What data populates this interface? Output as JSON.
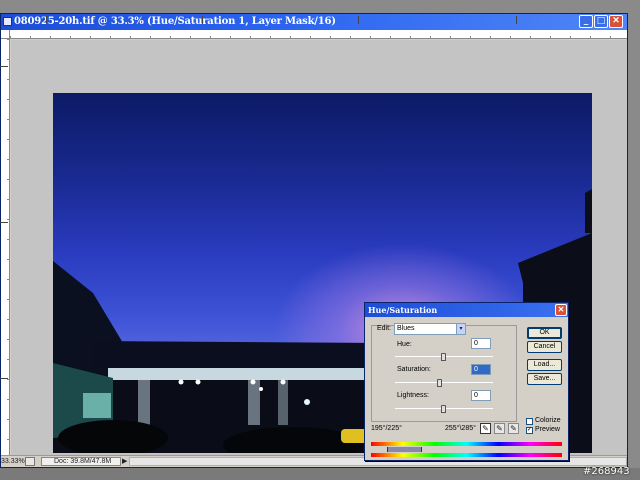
{
  "window": {
    "title": "080925-20h.tif @ 33.3% (Hue/Saturation 1, Layer Mask/16)",
    "minimize_glyph": "_",
    "maximize_glyph": "□",
    "close_glyph": "✕"
  },
  "status": {
    "zoom": "33.33%",
    "doc": "Doc: 39.8M/47.8M",
    "arrow": "▶"
  },
  "dialog": {
    "title": "Hue/Saturation",
    "close_glyph": "✕",
    "edit_label": "Edit:",
    "edit_value": "Blues",
    "edit_caret": "▾",
    "hue_label": "Hue:",
    "hue_value": "0",
    "saturation_label": "Saturation:",
    "saturation_value": "0",
    "lightness_label": "Lightness:",
    "lightness_value": "0",
    "ok_label": "OK",
    "cancel_label": "Cancel",
    "load_label": "Load...",
    "save_label": "Save...",
    "colorize_label": "Colorize",
    "colorize_checked": false,
    "preview_label": "Preview",
    "preview_checked": true,
    "preview_check_glyph": "✓",
    "range_left": "195°/225°",
    "range_right": "255°\\285°",
    "dropper_icons": [
      "eyedropper-icon",
      "eyedropper-plus-icon",
      "eyedropper-minus-icon"
    ],
    "dropper_glyphs": [
      "✎",
      "✎",
      "✎"
    ]
  },
  "watermark": "#268943",
  "colors": {
    "titlebar": "#1c4ed8",
    "close_red": "#d8523a",
    "sky_top": "#0c1a66",
    "sky_bottom": "#6d74e6"
  }
}
